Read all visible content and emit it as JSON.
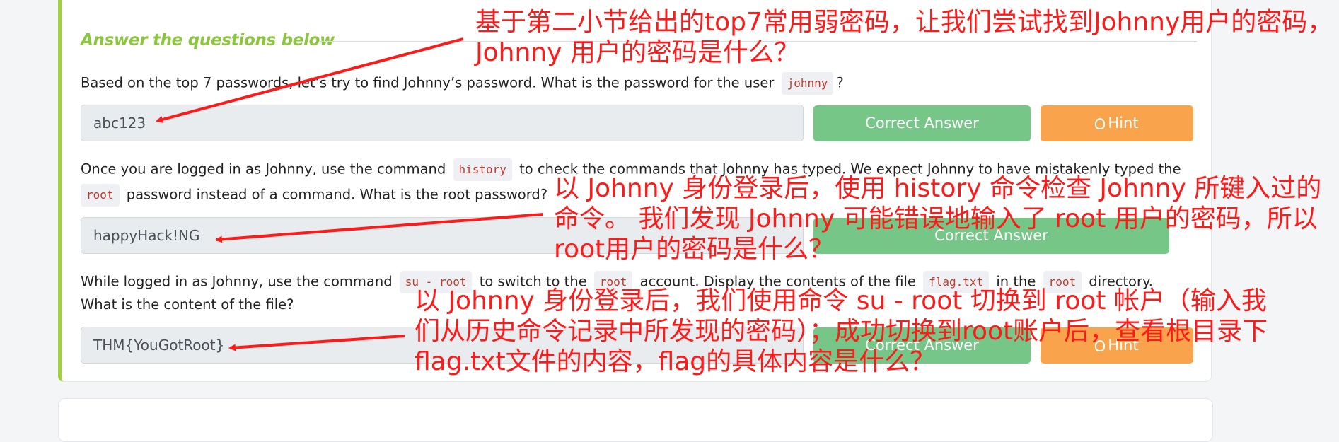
{
  "section": {
    "title": "Answer the questions below"
  },
  "q1": {
    "text_before": "Based on the top 7 passwords, let’s try to find Johnny’s password. What is the password for the user",
    "code": "johnny",
    "text_after": "?",
    "answer": "abc123",
    "correct_label": "Correct Answer",
    "hint_label": "Hint"
  },
  "q2": {
    "l1_a": "Once you are logged in as Johnny, use the command",
    "code_history": "history",
    "l1_b": "to check the commands that Johnny has typed. We expect Johnny to have mistakenly typed the",
    "code_root": "root",
    "l2": "password instead of a command. What is the root password?",
    "answer": "happyHack!NG",
    "correct_label": "Correct Answer"
  },
  "q3": {
    "l1_a": "While logged in as Johnny, use the command",
    "code_su": "su - root",
    "l1_b": "to switch to the",
    "code_root": "root",
    "l1_c": "account. Display the contents of the file",
    "code_file": "flag.txt",
    "l1_d": "in the",
    "code_root2": "root",
    "l1_e": "directory.",
    "l2": "What is the content of the file?",
    "answer": "THM{YouGotRoot}",
    "correct_label": "Correct Answer",
    "hint_label": "Hint"
  },
  "annotations": {
    "a1": "基于第二小节给出的top7常用弱密码，让我们尝试找到Johnny用户的密码，\nJohnny 用户的密码是什么？",
    "a2": "以 Johnny 身份登录后，使用 history 命令检查 Johnny 所键入过的\n命令。 我们发现 Johnny 可能错误地输入了 root 用户的密码，所以\nroot用户的密码是什么？",
    "a3": "以 Johnny 身份登录后，我们使用命令 su - root 切换到 root 帐户（输入我\n们从历史命令记录中所发现的密码）；成功切换到root账户后，查看根目录下\nflag.txt文件的内容，flag的具体内容是什么？"
  },
  "colors": {
    "accent_green": "#8cc63e",
    "correct": "#75c687",
    "hint": "#f9a44d",
    "annotation": "#ff1a1a"
  },
  "icons": {
    "hint": "lightbulb-icon"
  }
}
